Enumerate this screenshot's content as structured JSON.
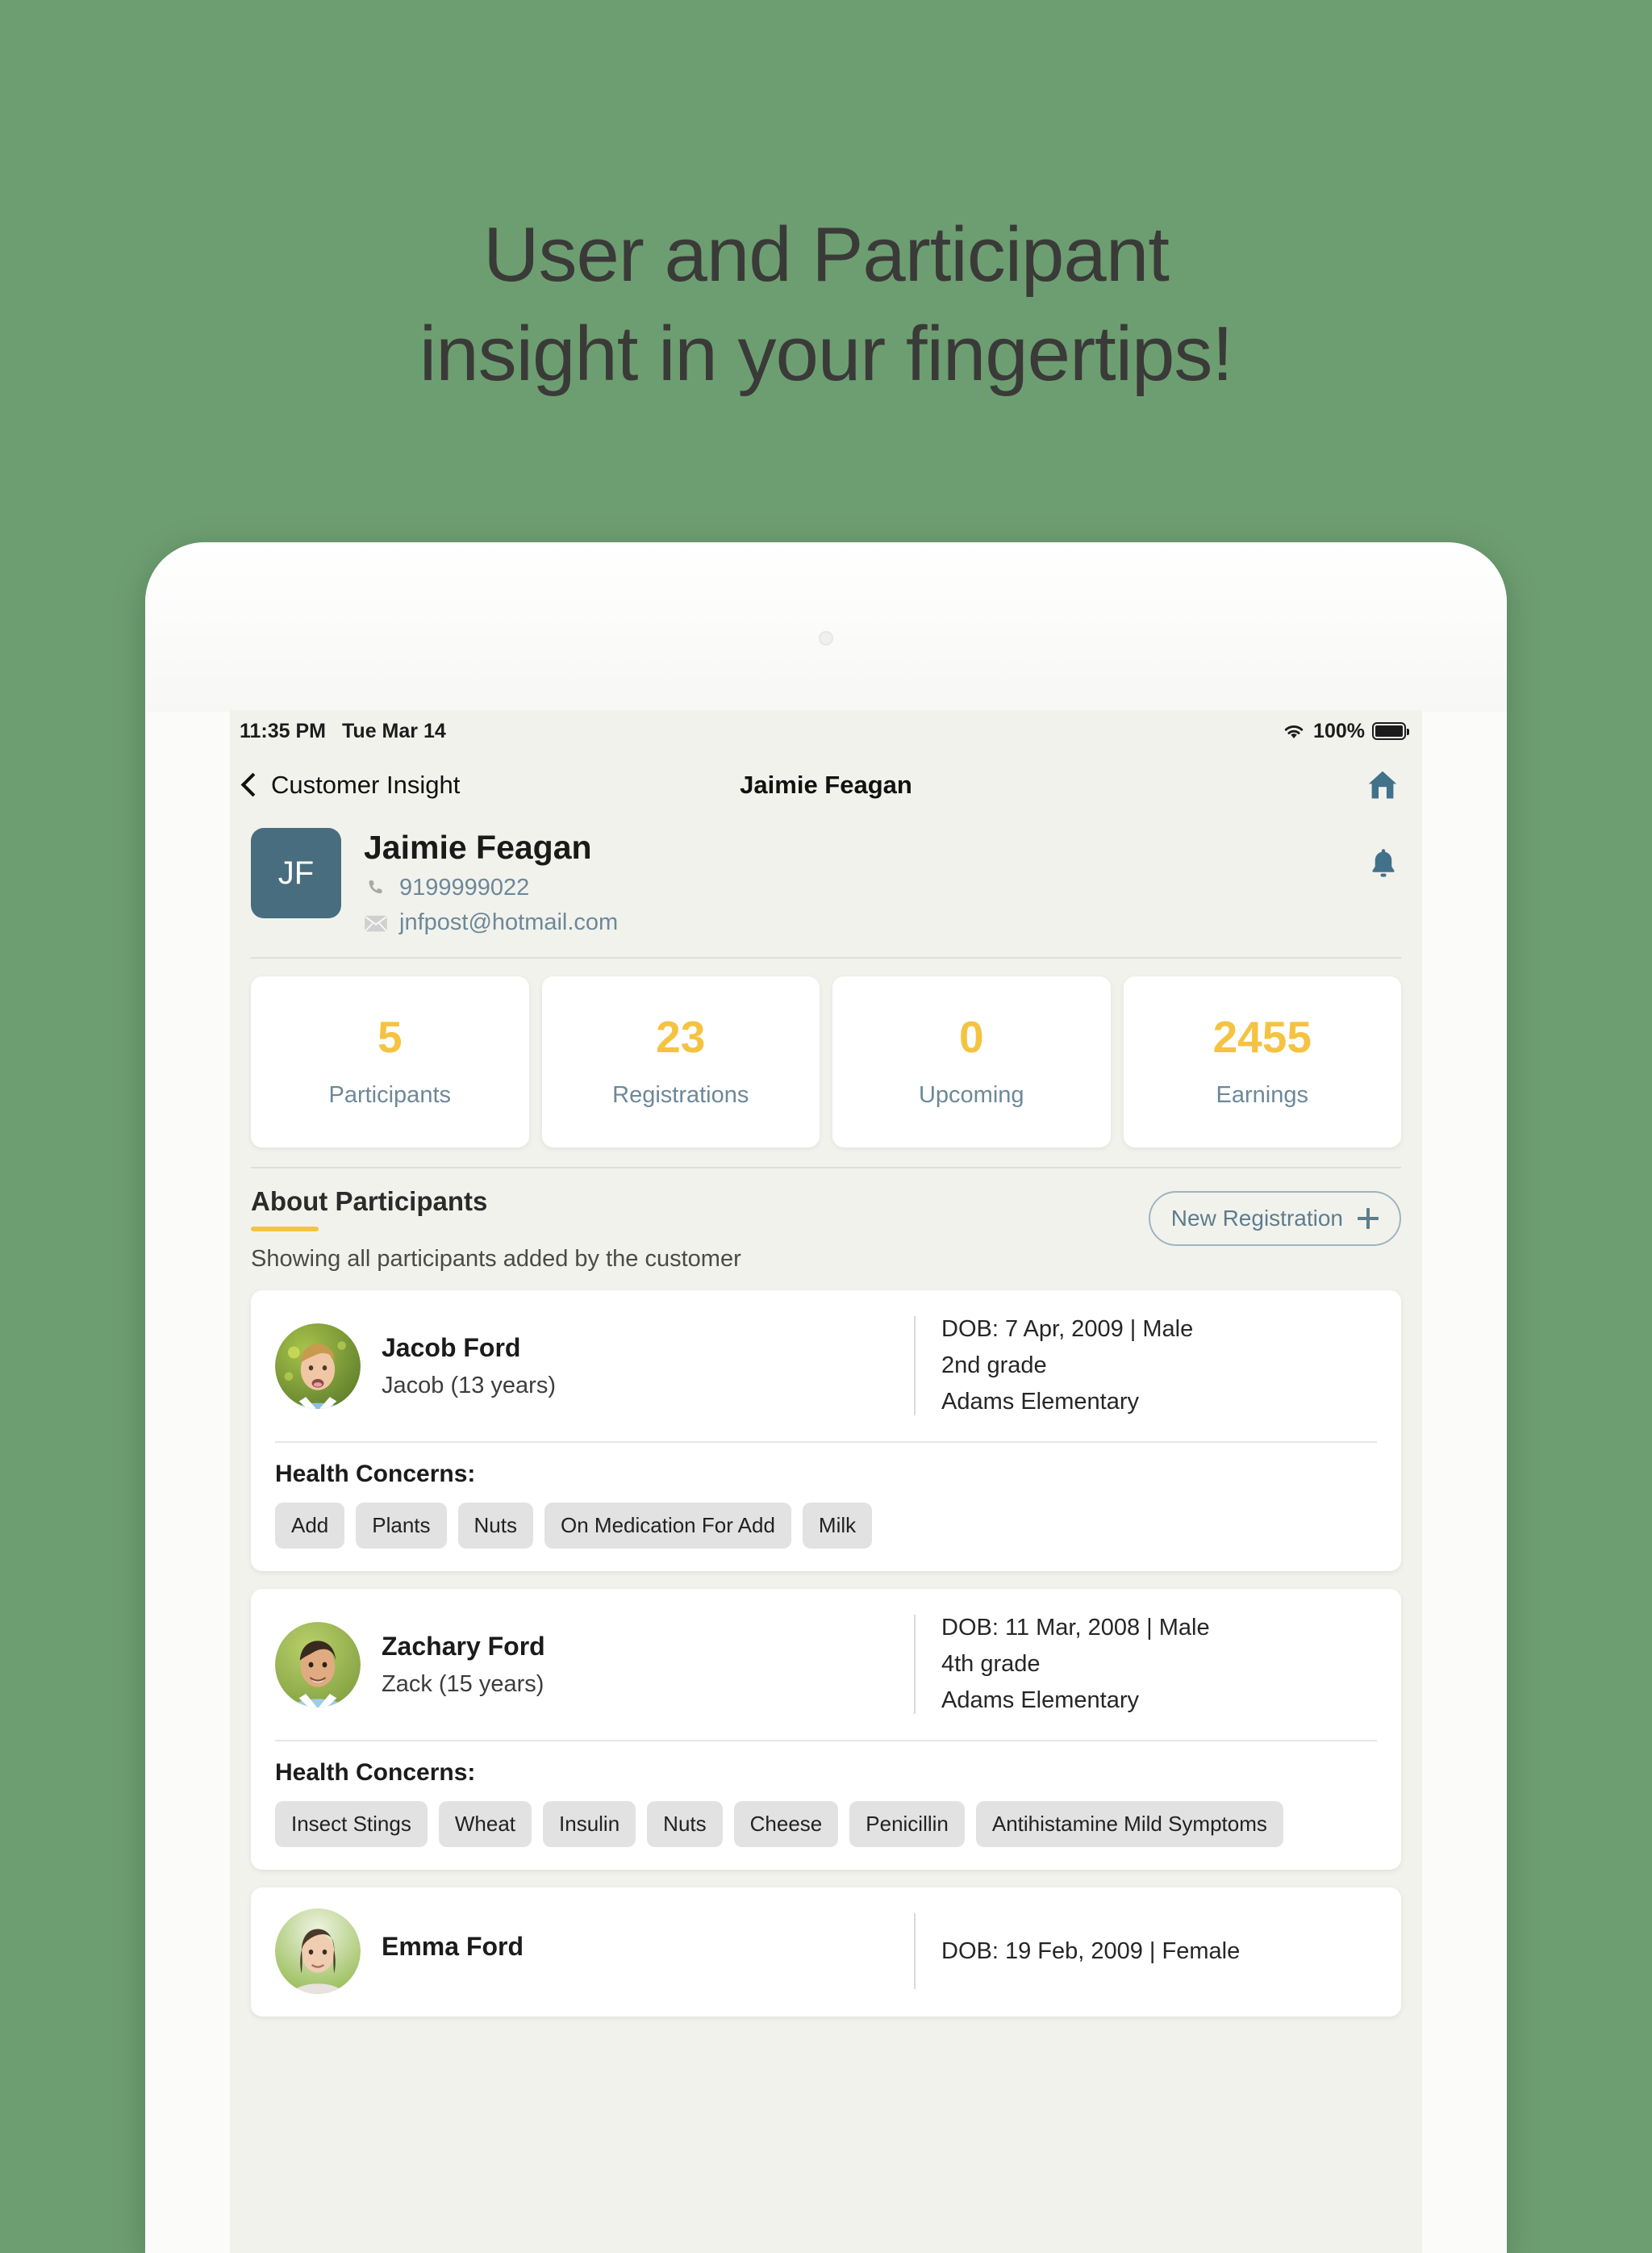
{
  "marketing": {
    "headline_line1": "User and Participant",
    "headline_line2": "insight in your fingertips!",
    "background_color": "#6d9e71",
    "headline_color": "#3a3a38"
  },
  "status_bar": {
    "time": "11:35 PM",
    "date": "Tue Mar 14",
    "wifi_icon": "wifi-icon",
    "battery_percent": "100%",
    "battery_icon": "battery-full-icon"
  },
  "nav_bar": {
    "back_label": "Customer Insight",
    "back_icon": "chevron-left-icon",
    "title": "Jaimie Feagan",
    "home_icon": "home-icon"
  },
  "profile": {
    "initials": "JF",
    "name": "Jaimie Feagan",
    "phone": "9199999022",
    "phone_icon": "phone-icon",
    "email": "jnfpost@hotmail.com",
    "email_icon": "mail-icon",
    "bell_icon": "bell-icon",
    "avatar_color": "#486d7e",
    "link_color": "#6d8899"
  },
  "stats": {
    "accent_color": "#f5c342",
    "items": [
      {
        "value": "5",
        "label": "Participants"
      },
      {
        "value": "23",
        "label": "Registrations"
      },
      {
        "value": "0",
        "label": "Upcoming"
      },
      {
        "value": "2455",
        "label": "Earnings"
      }
    ]
  },
  "section": {
    "title": "About Participants",
    "subtitle": "Showing all participants added by the customer",
    "new_registration_label": "New Registration",
    "new_registration_icon": "plus-icon",
    "underline_color": "#f5c342"
  },
  "participants": [
    {
      "name": "Jacob Ford",
      "alias": "Jacob (13 years)",
      "dob": "DOB: 7 Apr, 2009 | Male",
      "grade": "2nd grade",
      "school": "Adams Elementary",
      "health_label": "Health Concerns:",
      "health_concerns": [
        "Add",
        "Plants",
        "Nuts",
        "On Medication For Add",
        "Milk"
      ],
      "photo": "boy-blond-photo"
    },
    {
      "name": "Zachary Ford",
      "alias": "Zack (15 years)",
      "dob": "DOB: 11 Mar, 2008 | Male",
      "grade": "4th grade",
      "school": "Adams Elementary",
      "health_label": "Health Concerns:",
      "health_concerns": [
        "Insect Stings",
        "Wheat",
        "Insulin",
        "Nuts",
        "Cheese",
        "Penicillin",
        "Antihistamine Mild Symptoms"
      ],
      "photo": "boy-brunette-photo"
    },
    {
      "name": "Emma Ford",
      "alias": "",
      "dob": "DOB: 19 Feb, 2009 | Female",
      "grade": "",
      "school": "",
      "health_label": "",
      "health_concerns": [],
      "photo": "girl-photo"
    }
  ]
}
